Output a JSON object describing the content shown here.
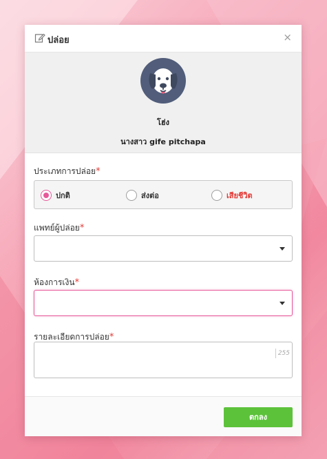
{
  "dialog": {
    "title": "ปล่อย",
    "title_icon": "edit-icon",
    "close_label": "×"
  },
  "profile": {
    "avatar_icon": "dog-icon",
    "pet_name": "โฮ่ง",
    "owner_name": "นางสาว gife pitchapa"
  },
  "form": {
    "release_type": {
      "label": "ประเภทการปล่อย",
      "required_mark": "*",
      "options": [
        {
          "label": "ปกติ",
          "checked": true
        },
        {
          "label": "ส่งต่อ",
          "checked": false
        },
        {
          "label": "เสียชีวิต",
          "checked": false
        }
      ]
    },
    "doctor": {
      "label": "แพทย์ผู้ปล่อย",
      "required_mark": "*",
      "value": ""
    },
    "cashier_room": {
      "label": "ห้องการเงิน",
      "required_mark": "*",
      "value": ""
    },
    "details": {
      "label": "รายละเอียดการปล่อย",
      "required_mark": "*",
      "value": "",
      "max_length": "255"
    }
  },
  "footer": {
    "ok_label": "ตกลง"
  },
  "colors": {
    "accent_pink": "#e6589a",
    "ok_green": "#5cc23a",
    "danger_red": "#e53935",
    "avatar_bg": "#515d7a"
  }
}
